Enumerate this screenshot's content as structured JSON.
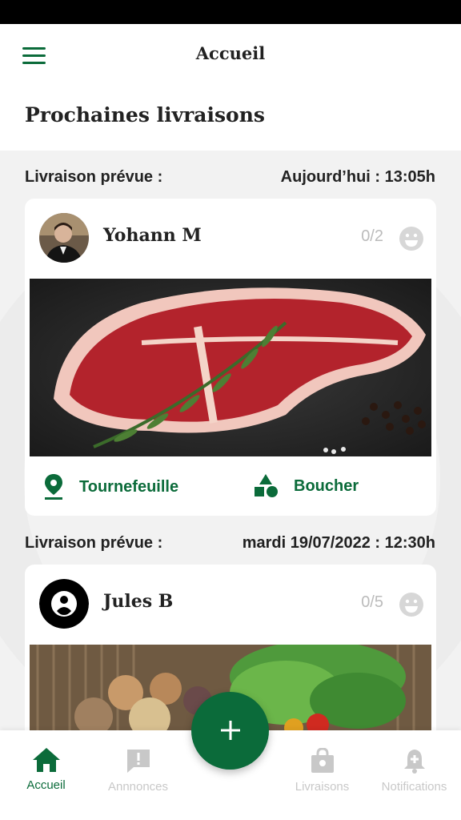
{
  "header": {
    "title": "Accueil"
  },
  "section": {
    "title": "Prochaines livraisons"
  },
  "deliveries": [
    {
      "label": "Livraison prévue :",
      "time": "Aujourd’hui : 13:05h",
      "name": "Yohann M",
      "count": "0/2",
      "location": "Tournefeuille",
      "category": "Boucher"
    },
    {
      "label": "Livraison prévue :",
      "time": "mardi 19/07/2022 : 12:30h",
      "name": "Jules B",
      "count": "0/5"
    }
  ],
  "nav": {
    "items": [
      {
        "label": "Accueil",
        "icon": "home-icon"
      },
      {
        "label": "Annnonces",
        "icon": "announcement-icon"
      },
      {
        "label": "Livraisons",
        "icon": "bag-icon"
      },
      {
        "label": "Notifications",
        "icon": "bell-icon"
      }
    ],
    "fab_icon": "plus-icon"
  },
  "colors": {
    "accent": "#0b6b3a",
    "inactive": "#c8c8c8",
    "background": "#f2f2f2"
  }
}
